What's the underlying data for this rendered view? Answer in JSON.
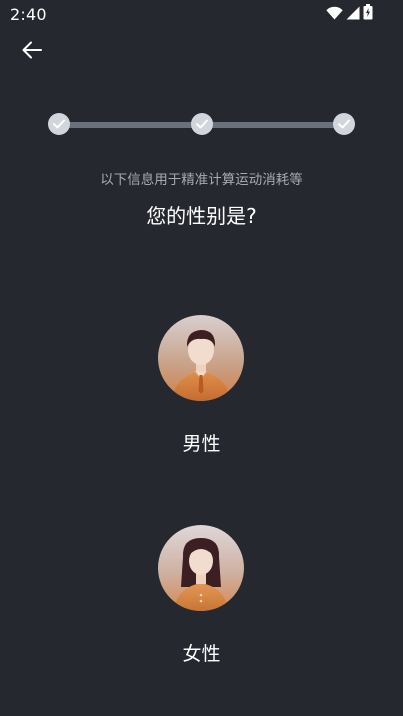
{
  "status_bar": {
    "time": "2:40",
    "icons": [
      "wifi-icon",
      "signal-icon",
      "battery-icon"
    ]
  },
  "header": {
    "back_icon": "arrow-left-icon"
  },
  "progress": {
    "total_steps": 3,
    "completed_steps": 3,
    "step_icon": "check-icon"
  },
  "page": {
    "subtitle": "以下信息用于精准计算运动消耗等",
    "question": "您的性别是?"
  },
  "options": [
    {
      "label": "男性",
      "icon": "male-avatar-icon"
    },
    {
      "label": "女性",
      "icon": "female-avatar-icon"
    }
  ],
  "colors": {
    "background": "#262830",
    "progress_track": "#6a707c",
    "progress_step": "#d2d5db",
    "subtitle_text": "#a6a9b0",
    "accent_orange": "#e08a3c"
  }
}
